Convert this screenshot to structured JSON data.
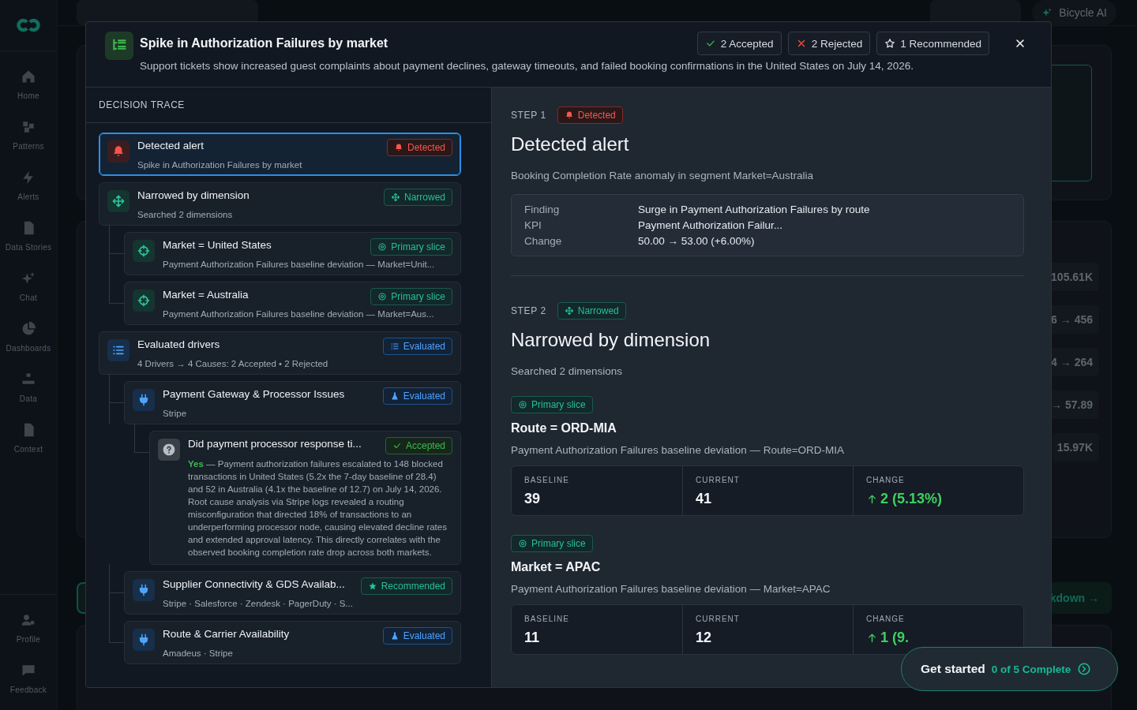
{
  "nav": [
    {
      "label": "Home",
      "kind": "home"
    },
    {
      "label": "Patterns",
      "kind": "squares"
    },
    {
      "label": "Alerts",
      "kind": "bolt"
    },
    {
      "label": "Data Stories",
      "kind": "doc"
    },
    {
      "label": "Chat",
      "kind": "sparkle"
    },
    {
      "label": "Dashboards",
      "kind": "pie"
    },
    {
      "label": "Data",
      "kind": "hierarchy"
    },
    {
      "label": "Context",
      "kind": "doc"
    }
  ],
  "nav_bottom": [
    {
      "label": "Profile",
      "kind": "user"
    },
    {
      "label": "Feedback",
      "kind": "bubble"
    }
  ],
  "background": {
    "assistant_button": "Bicycle AI",
    "metric_values": [
      "105.61K",
      "6 → 456",
      "4 → 264",
      "→ 57.89",
      "15.97K"
    ],
    "link_button": "kdown →"
  },
  "modal": {
    "title": "Spike in Authorization Failures by market",
    "description": "Support tickets show increased guest complaints about payment declines, gateway timeouts, and failed booking confirmations in the United States on July 14, 2026.",
    "summary": [
      {
        "kind": "accepted",
        "label": "2 Accepted"
      },
      {
        "kind": "rejected",
        "label": "2 Rejected"
      },
      {
        "kind": "recommended",
        "label": "1 Recommended"
      }
    ],
    "trace": {
      "heading": "DECISION TRACE",
      "items": [
        {
          "kind": "bell",
          "title": "Detected alert",
          "subtitle": "Spike in Authorization Failures by market",
          "badge": {
            "kind": "detected",
            "label": "Detected"
          },
          "selected": true
        },
        {
          "kind": "move",
          "title": "Narrowed by dimension",
          "subtitle": "Searched 2 dimensions",
          "badge": {
            "kind": "narrowed",
            "label": "Narrowed"
          },
          "selected": false,
          "children": [
            {
              "kind": "crosshair",
              "title": "Market = United States",
              "subtitle": "Payment Authorization Failures baseline deviation — Market=Unit...",
              "badge": {
                "kind": "primary",
                "label": "Primary slice"
              },
              "selected": false
            },
            {
              "kind": "crosshair",
              "title": "Market = Australia",
              "subtitle": "Payment Authorization Failures baseline deviation — Market=Aus...",
              "badge": {
                "kind": "primary",
                "label": "Primary slice"
              },
              "selected": false
            }
          ]
        },
        {
          "kind": "list",
          "title": "Evaluated drivers",
          "subtitle": "4 Drivers → 4 Causes: 2 Accepted • 2 Rejected",
          "badge": {
            "kind": "evaluated",
            "label": "Evaluated"
          },
          "selected": false,
          "children": [
            {
              "kind": "plug",
              "title": "Payment Gateway & Processor Issues",
              "subtitle": "Stripe",
              "badge": {
                "kind": "tested",
                "label": "Evaluated"
              },
              "selected": false,
              "children": [
                {
                  "kind": "question",
                  "title": "Did payment processor response ti...",
                  "answer": "**Yes** — Payment authorization failures escalated to 148 blocked transactions in United States (5.2x the 7-day baseline of 28.4) and 52 in Australia (4.1x the baseline of 12.7) on July 14, 2026. Root cause analysis via Stripe logs revealed a routing misconfiguration that directed 18% of transactions to an underperforming processor node, causing elevated decline rates and extended approval latency. This directly correlates with the observed booking completion rate drop across both markets.",
                  "badge": {
                    "kind": "accepted",
                    "label": "Accepted"
                  },
                  "selected": false
                }
              ]
            },
            {
              "kind": "plug",
              "title": "Supplier Connectivity & GDS Availab...",
              "subtitle": "Stripe · Salesforce · Zendesk · PagerDuty · S...",
              "badge": {
                "kind": "recommended",
                "label": "Recommended"
              },
              "selected": false
            },
            {
              "kind": "plug",
              "title": "Route & Carrier Availability",
              "subtitle": "Amadeus · Stripe",
              "badge": {
                "kind": "tested",
                "label": "Evaluated"
              },
              "selected": false
            }
          ]
        }
      ]
    },
    "steps": [
      {
        "step": "STEP 1",
        "badge": {
          "kind": "detected",
          "label": "Detected"
        },
        "title": "Detected alert",
        "description": "Booking Completion Rate anomaly in segment Market=Australia",
        "details": [
          {
            "label": "Finding",
            "value": "Surge in Payment Authorization Failures by route"
          },
          {
            "label": "KPI",
            "value": "Payment Authorization Failur..."
          },
          {
            "label": "Change",
            "value": "50.00 → 53.00 (+6.00%)"
          }
        ]
      },
      {
        "step": "STEP 2",
        "badge": {
          "kind": "narrowed",
          "label": "Narrowed"
        },
        "title": "Narrowed by dimension",
        "description": "Searched 2 dimensions",
        "slices": [
          {
            "badge": {
              "kind": "primary",
              "label": "Primary slice"
            },
            "title": "Route = ORD-MIA",
            "description": "Payment Authorization Failures baseline deviation — Route=ORD-MIA",
            "metrics": [
              {
                "label": "BASELINE",
                "value": "39",
                "kind": "plain"
              },
              {
                "label": "CURRENT",
                "value": "41",
                "kind": "plain"
              },
              {
                "label": "CHANGE",
                "value": "2 (5.13%)",
                "kind": "up"
              }
            ]
          },
          {
            "badge": {
              "kind": "primary",
              "label": "Primary slice"
            },
            "title": "Market = APAC",
            "description": "Payment Authorization Failures baseline deviation — Market=APAC",
            "metrics": [
              {
                "label": "BASELINE",
                "value": "11",
                "kind": "plain"
              },
              {
                "label": "CURRENT",
                "value": "12",
                "kind": "plain"
              },
              {
                "label": "CHANGE",
                "value": "1 (9.",
                "kind": "up"
              }
            ]
          }
        ]
      }
    ]
  },
  "onboarding": {
    "label": "Get started",
    "progress": "0 of 5 Complete"
  }
}
